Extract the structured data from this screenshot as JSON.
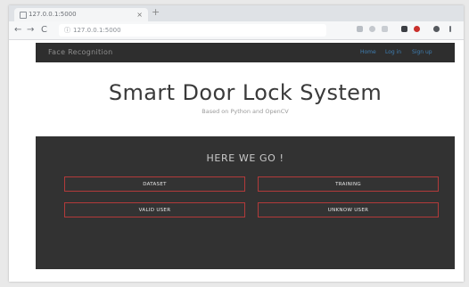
{
  "browser": {
    "tab_title": "127.0.0.1:5000",
    "tab_close": "×",
    "new_tab": "+",
    "url": "127.0.0.1:5000",
    "nav": {
      "back": "←",
      "forward": "→",
      "reload": "C",
      "info": "ⓘ"
    }
  },
  "site": {
    "brand": "Face Recognition",
    "nav_links": [
      "Home",
      "Log in",
      "Sign up"
    ]
  },
  "hero": {
    "title": "Smart Door Lock System",
    "subtitle": "Based on Python and OpenCV"
  },
  "panel": {
    "heading": "HERE WE GO !",
    "buttons": [
      "DATASET",
      "TRAINING",
      "VALID USER",
      "UNKNOW USER"
    ]
  },
  "colors": {
    "nav_bg": "#2e2e2e",
    "panel_bg": "#323232",
    "button_border": "#b23a3a",
    "link": "#3f7fb3"
  }
}
